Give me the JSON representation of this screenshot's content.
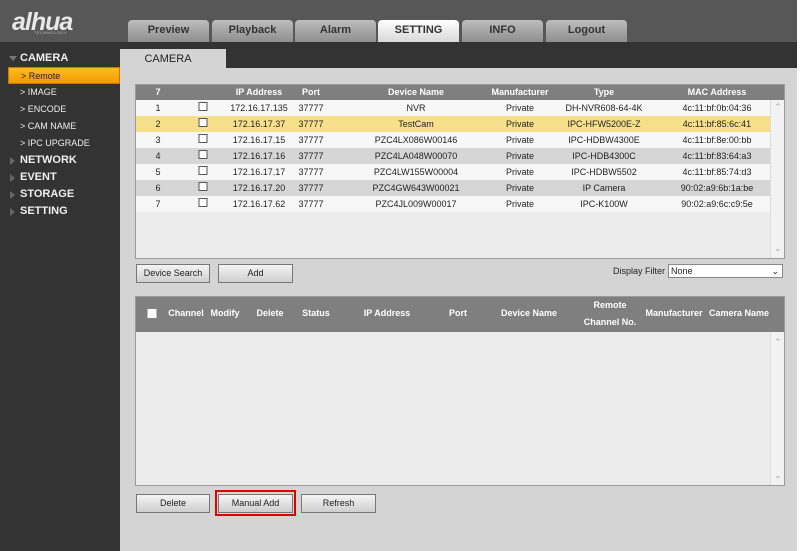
{
  "logo": {
    "text": "alhua",
    "sub": "TECHNOLOGY"
  },
  "nav": [
    "Preview",
    "Playback",
    "Alarm",
    "SETTING",
    "INFO",
    "Logout"
  ],
  "nav_active": "SETTING",
  "sidebar": {
    "camera": "CAMERA",
    "items": [
      "Remote",
      "IMAGE",
      "ENCODE",
      "CAM NAME",
      "IPC UPGRADE"
    ],
    "sections": [
      "NETWORK",
      "EVENT",
      "STORAGE",
      "SETTING"
    ]
  },
  "content_tab": "CAMERA",
  "device_table": {
    "headers": [
      "7",
      "",
      "IP Address",
      "Port",
      "Device Name",
      "Manufacturer",
      "Type",
      "MAC Address"
    ],
    "rows": [
      [
        "1",
        "172.16.17.135",
        "37777",
        "NVR",
        "Private",
        "DH-NVR608-64-4K",
        "4c:11:bf:0b:04:36"
      ],
      [
        "2",
        "172.16.17.37",
        "37777",
        "TestCam",
        "Private",
        "IPC-HFW5200E-Z",
        "4c:11:bf:85:6c:41"
      ],
      [
        "3",
        "172.16.17.15",
        "37777",
        "PZC4LX086W00146",
        "Private",
        "IPC-HDBW4300E",
        "4c:11:bf:8e:00:bb"
      ],
      [
        "4",
        "172.16.17.16",
        "37777",
        "PZC4LA048W00070",
        "Private",
        "IPC-HDB4300C",
        "4c:11:bf:83:64:a3"
      ],
      [
        "5",
        "172.16.17.17",
        "37777",
        "PZC4LW155W00004",
        "Private",
        "IPC-HDBW5502",
        "4c:11:bf:85:74:d3"
      ],
      [
        "6",
        "172.16.17.20",
        "37777",
        "PZC4GW643W00021",
        "Private",
        "IP Camera",
        "90:02:a9:6b:1a:be"
      ],
      [
        "7",
        "172.16.17.62",
        "37777",
        "PZC4JL009W00017",
        "Private",
        "IPC-K100W",
        "90:02:a9:6c:c9:5e"
      ]
    ],
    "highlight_color": "#f7e08a"
  },
  "buttons": {
    "device_search": "Device Search",
    "add": "Add",
    "delete": "Delete",
    "manual_add": "Manual Add",
    "refresh": "Refresh"
  },
  "filter": {
    "label": "Display Filter",
    "value": "None"
  },
  "added_table": {
    "headers": [
      "Channel",
      "Modify",
      "Delete",
      "Status",
      "IP Address",
      "Port",
      "Device Name",
      "Remote",
      "Channel No.",
      "Manufacturer",
      "Camera Name"
    ]
  }
}
